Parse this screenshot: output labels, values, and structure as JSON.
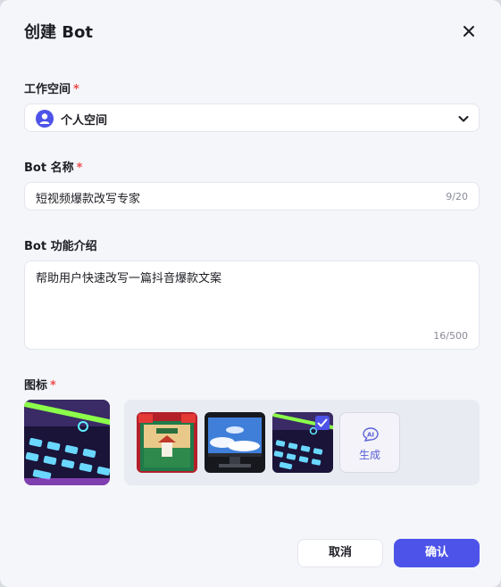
{
  "dialog": {
    "title": "创建 Bot",
    "close_icon": "close-icon"
  },
  "workspace": {
    "label": "工作空间",
    "required_mark": "*",
    "selected": "个人空间",
    "icon": "user-avatar-icon"
  },
  "bot_name": {
    "label": "Bot 名称",
    "required_mark": "*",
    "value": "短视频爆款改写专家",
    "counter": "9/20"
  },
  "bot_intro": {
    "label": "Bot 功能介绍",
    "value": "帮助用户快速改写一篇抖音爆款文案",
    "counter": "16/500"
  },
  "icon_section": {
    "label": "图标",
    "required_mark": "*",
    "options": [
      "chinese-poster-image",
      "monitor-sky-image",
      "neon-keyboard-image"
    ],
    "selected_index": 2,
    "ai_badge": "AI",
    "generate_label": "生成"
  },
  "footer": {
    "cancel_label": "取消",
    "confirm_label": "确认"
  },
  "colors": {
    "accent": "#4d53e8",
    "required": "#f04b4b",
    "background": "#f5f6fa"
  }
}
